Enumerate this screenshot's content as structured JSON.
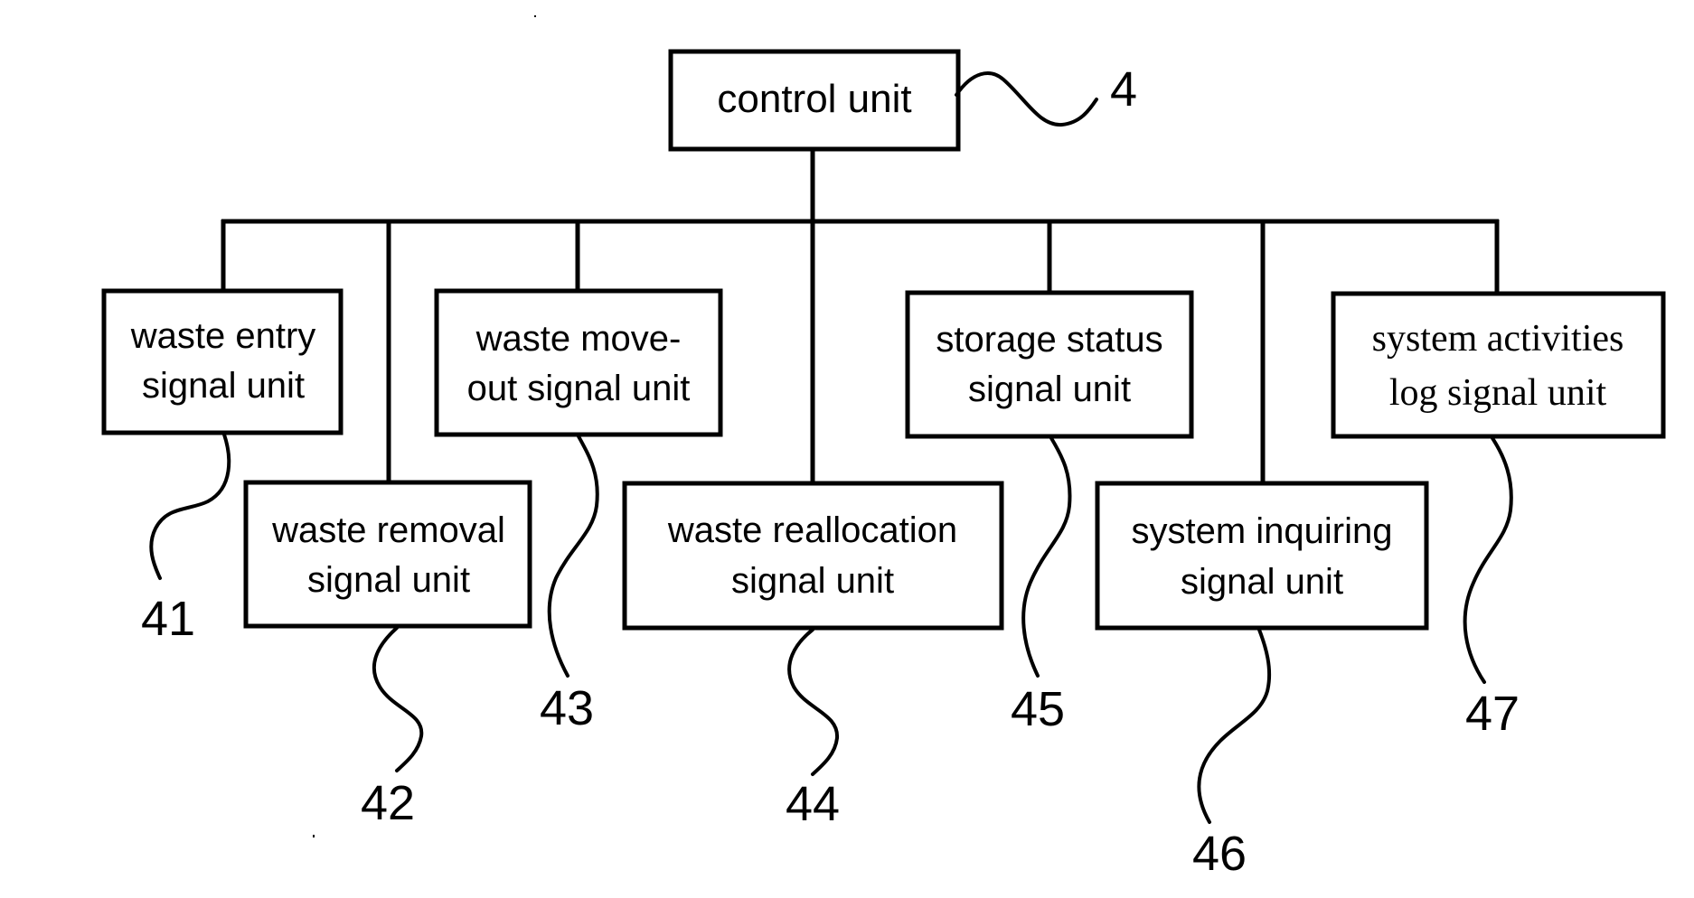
{
  "diagram": {
    "type": "block-diagram",
    "root": {
      "id": "control-unit",
      "label": "control unit",
      "ref": "4"
    },
    "children": [
      {
        "id": "waste-entry",
        "lines": [
          "waste entry",
          "signal unit"
        ],
        "ref": "41",
        "font": "sans"
      },
      {
        "id": "waste-removal",
        "lines": [
          "waste removal",
          "signal unit"
        ],
        "ref": "42",
        "font": "sans"
      },
      {
        "id": "waste-move-out",
        "lines": [
          "waste move-",
          "out signal unit"
        ],
        "ref": "43",
        "font": "sans"
      },
      {
        "id": "waste-reallocation",
        "lines": [
          "waste reallocation",
          "signal unit"
        ],
        "ref": "44",
        "font": "sans"
      },
      {
        "id": "storage-status",
        "lines": [
          "storage status",
          "signal unit"
        ],
        "ref": "45",
        "font": "sans"
      },
      {
        "id": "system-inquiring",
        "lines": [
          "system inquiring",
          "signal unit"
        ],
        "ref": "46",
        "font": "sans"
      },
      {
        "id": "system-activities-log",
        "lines": [
          "system activities",
          "log signal unit"
        ],
        "ref": "47",
        "font": "serif"
      }
    ],
    "edges": [
      {
        "from": "control-unit",
        "to": "waste-entry"
      },
      {
        "from": "control-unit",
        "to": "waste-removal"
      },
      {
        "from": "control-unit",
        "to": "waste-move-out"
      },
      {
        "from": "control-unit",
        "to": "waste-reallocation"
      },
      {
        "from": "control-unit",
        "to": "storage-status"
      },
      {
        "from": "control-unit",
        "to": "system-inquiring"
      },
      {
        "from": "control-unit",
        "to": "system-activities-log"
      }
    ]
  }
}
